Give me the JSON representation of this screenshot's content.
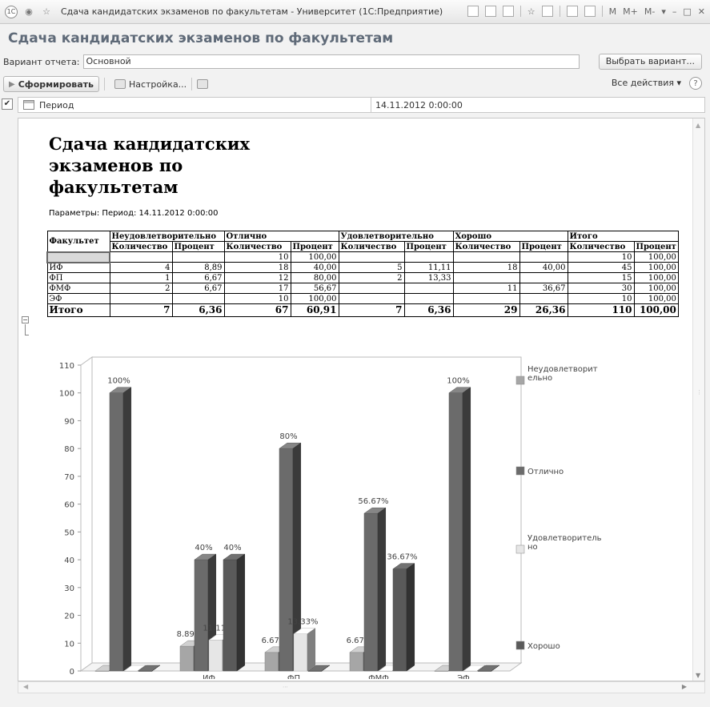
{
  "window": {
    "title": "Сдача кандидатских экзаменов по факультетам - Университет  (1С:Предприятие)",
    "logo": "1С",
    "menu_m": "M",
    "menu_mplus": "M+",
    "menu_mminus": "M-"
  },
  "page_title": "Сдача кандидатских экзаменов по факультетам",
  "variant": {
    "label": "Вариант отчета:",
    "value": "Основной",
    "choose_button": "Выбрать вариант..."
  },
  "toolbar": {
    "run": "Сформировать",
    "settings": "Настройка...",
    "all_actions": "Все действия ▾"
  },
  "period": {
    "label": "Период",
    "value": "14.11.2012 0:00:00",
    "checked": true
  },
  "report": {
    "title": "Сдача кандидатских экзаменов по факультетам",
    "params": "Параметры:    Период: 14.11.2012 0:00:00",
    "table": {
      "col_faculty": "Факультет",
      "groups": [
        "Неудовлетворительно",
        "Отлично",
        "Удовлетворительно",
        "Хорошо",
        "Итого"
      ],
      "sub_count": "Количество",
      "sub_pct": "Процент",
      "rows": [
        {
          "name": "",
          "cells": [
            "",
            "",
            "10",
            "100,00",
            "",
            "",
            "",
            "",
            "10",
            "100,00"
          ]
        },
        {
          "name": "ИФ",
          "cells": [
            "4",
            "8,89",
            "18",
            "40,00",
            "5",
            "11,11",
            "18",
            "40,00",
            "45",
            "100,00"
          ]
        },
        {
          "name": "ФП",
          "cells": [
            "1",
            "6,67",
            "12",
            "80,00",
            "2",
            "13,33",
            "",
            "",
            "15",
            "100,00"
          ]
        },
        {
          "name": "ФМФ",
          "cells": [
            "2",
            "6,67",
            "17",
            "56,67",
            "",
            "",
            "11",
            "36,67",
            "30",
            "100,00"
          ]
        },
        {
          "name": "ЭФ",
          "cells": [
            "",
            "",
            "10",
            "100,00",
            "",
            "",
            "",
            "",
            "10",
            "100,00"
          ]
        }
      ],
      "total": {
        "name": "Итого",
        "cells": [
          "7",
          "6,36",
          "67",
          "60,91",
          "7",
          "6,36",
          "29",
          "26,36",
          "110",
          "100,00"
        ]
      }
    }
  },
  "chart_data": {
    "type": "bar",
    "categories": [
      "",
      "ИФ",
      "ФП",
      "ФМФ",
      "ЭФ"
    ],
    "ylim": [
      0,
      110
    ],
    "yticks": [
      0,
      10,
      20,
      30,
      40,
      50,
      60,
      70,
      80,
      90,
      100,
      110
    ],
    "series": [
      {
        "name": "Неудовлетворительно",
        "values": [
          0,
          8.89,
          6.67,
          6.67,
          0
        ],
        "labels": [
          "",
          "8.89%",
          "6.67%",
          "6.67%",
          ""
        ],
        "color": "#a6a6a6"
      },
      {
        "name": "Отлично",
        "values": [
          100,
          40,
          80,
          56.67,
          100
        ],
        "labels": [
          "100%",
          "40%",
          "80%",
          "56.67%",
          "100%"
        ],
        "color": "#6b6b6b"
      },
      {
        "name": "Удовлетворительно",
        "values": [
          0,
          11.11,
          13.33,
          0,
          0
        ],
        "labels": [
          "",
          "11.11%",
          "13.33%",
          "",
          ""
        ],
        "color": "#e6e6e6"
      },
      {
        "name": "Хорошо",
        "values": [
          0,
          40,
          0,
          36.67,
          0
        ],
        "labels": [
          "",
          "40%",
          "",
          "36.67%",
          ""
        ],
        "color": "#5a5a5a"
      }
    ],
    "legend_labels": [
      "Неудовлетворит ельно",
      "Отлично",
      "Удовлетворитель но",
      "Хорошо"
    ],
    "legend_position": "right",
    "grid": false
  }
}
